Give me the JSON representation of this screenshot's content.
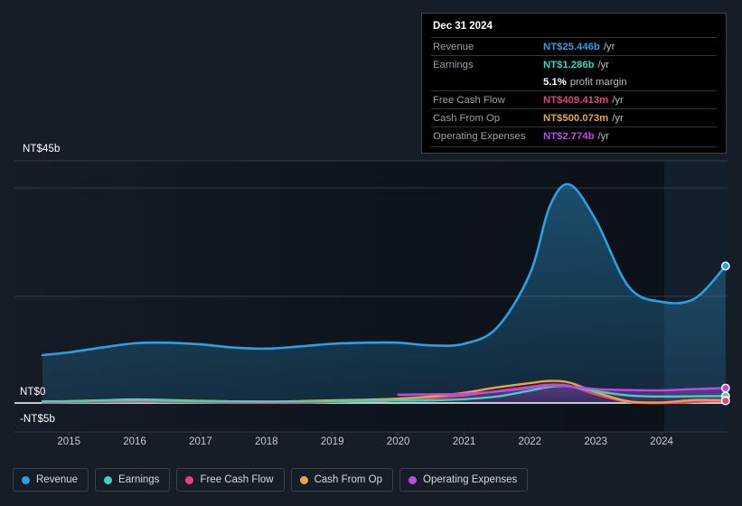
{
  "theme": {
    "background": "#161d27",
    "plot_background": "#10161f",
    "forecast_band": "#16222e",
    "gridline": "#2b3340",
    "zero_line": "#ffffff",
    "axis_text": "#c8ccd4"
  },
  "tooltip": {
    "date": "Dec 31 2024",
    "rows": [
      {
        "key": "Revenue",
        "value": "NT$25.446b",
        "unit": "/yr",
        "color": "#2e9fe0"
      },
      {
        "key": "Earnings",
        "value": "NT$1.286b",
        "unit": "/yr",
        "color": "#3bd4bb"
      },
      {
        "key": "",
        "value": "5.1%",
        "unit": "profit margin",
        "color": "#ffffff"
      },
      {
        "key": "Free Cash Flow",
        "value": "NT$409.413m",
        "unit": "/yr",
        "color": "#e0457b"
      },
      {
        "key": "Cash From Op",
        "value": "NT$500.073m",
        "unit": "/yr",
        "color": "#eba43f"
      },
      {
        "key": "Operating Expenses",
        "value": "NT$2.774b",
        "unit": "/yr",
        "color": "#c148e8"
      }
    ]
  },
  "legend": {
    "items": [
      {
        "label": "Revenue",
        "color": "#2e9fe0"
      },
      {
        "label": "Earnings",
        "color": "#3bd4bb"
      },
      {
        "label": "Free Cash Flow",
        "color": "#e0457b"
      },
      {
        "label": "Cash From Op",
        "color": "#eba43f"
      },
      {
        "label": "Operating Expenses",
        "color": "#c148e8"
      }
    ]
  },
  "chart_data": {
    "type": "area",
    "title": "",
    "xlabel": "",
    "ylabel": "NT$",
    "x_tick_labels": [
      "2015",
      "2016",
      "2017",
      "2018",
      "2019",
      "2020",
      "2021",
      "2022",
      "2023",
      "2024"
    ],
    "y_tick_labels": [
      "NT$45b",
      "NT$0",
      "-NT$5b"
    ],
    "ylim": [
      -5,
      45
    ],
    "y_axis_unit": "NT$ billions",
    "grid": true,
    "legend_position": "bottom-left",
    "forecast_region_start": "2024-07",
    "x": [
      "2014.6",
      "2015",
      "2015.5",
      "2016",
      "2016.5",
      "2017",
      "2017.5",
      "2018",
      "2018.5",
      "2019",
      "2019.5",
      "2020",
      "2020.5",
      "2021",
      "2021.5",
      "2022",
      "2022.3",
      "2022.6",
      "2023",
      "2023.5",
      "2024",
      "2024.5",
      "2024.97"
    ],
    "series": [
      {
        "name": "Revenue",
        "color": "#2e9fe0",
        "filled": true,
        "values": [
          8.9,
          9.4,
          10.3,
          11.1,
          11.2,
          10.9,
          10.3,
          10.1,
          10.5,
          11.0,
          11.2,
          11.2,
          10.7,
          11.0,
          14.0,
          24.0,
          36.5,
          40.6,
          34.0,
          21.6,
          18.8,
          19.4,
          25.446
        ]
      },
      {
        "name": "Earnings",
        "color": "#3bd4bb",
        "filled": false,
        "values": [
          0.25,
          0.3,
          0.45,
          0.5,
          0.45,
          0.35,
          0.3,
          0.25,
          0.3,
          0.35,
          0.4,
          0.45,
          0.5,
          0.7,
          1.2,
          2.3,
          3.0,
          3.1,
          2.2,
          1.4,
          1.2,
          1.25,
          1.286
        ]
      },
      {
        "name": "Free Cash Flow",
        "color": "#e0457b",
        "filled": false,
        "values": [
          0.1,
          0.15,
          0.2,
          0.25,
          0.2,
          0.15,
          0.1,
          0.05,
          0.1,
          0.2,
          0.3,
          0.5,
          0.9,
          1.4,
          2.2,
          3.0,
          3.4,
          3.2,
          1.6,
          0.2,
          0.0,
          0.2,
          0.409
        ]
      },
      {
        "name": "Cash From Op",
        "color": "#eba43f",
        "filled": false,
        "values": [
          0.3,
          0.35,
          0.5,
          0.65,
          0.55,
          0.4,
          0.3,
          0.25,
          0.35,
          0.5,
          0.6,
          0.8,
          1.2,
          1.9,
          2.9,
          3.7,
          4.1,
          3.8,
          2.0,
          0.3,
          0.1,
          0.55,
          0.5
        ]
      },
      {
        "name": "Operating Expenses",
        "color": "#c148e8",
        "filled": true,
        "values": [
          null,
          null,
          null,
          null,
          null,
          null,
          null,
          null,
          null,
          null,
          null,
          1.55,
          1.6,
          1.7,
          2.1,
          2.8,
          3.2,
          3.1,
          2.6,
          2.4,
          2.35,
          2.6,
          2.774
        ]
      }
    ]
  }
}
